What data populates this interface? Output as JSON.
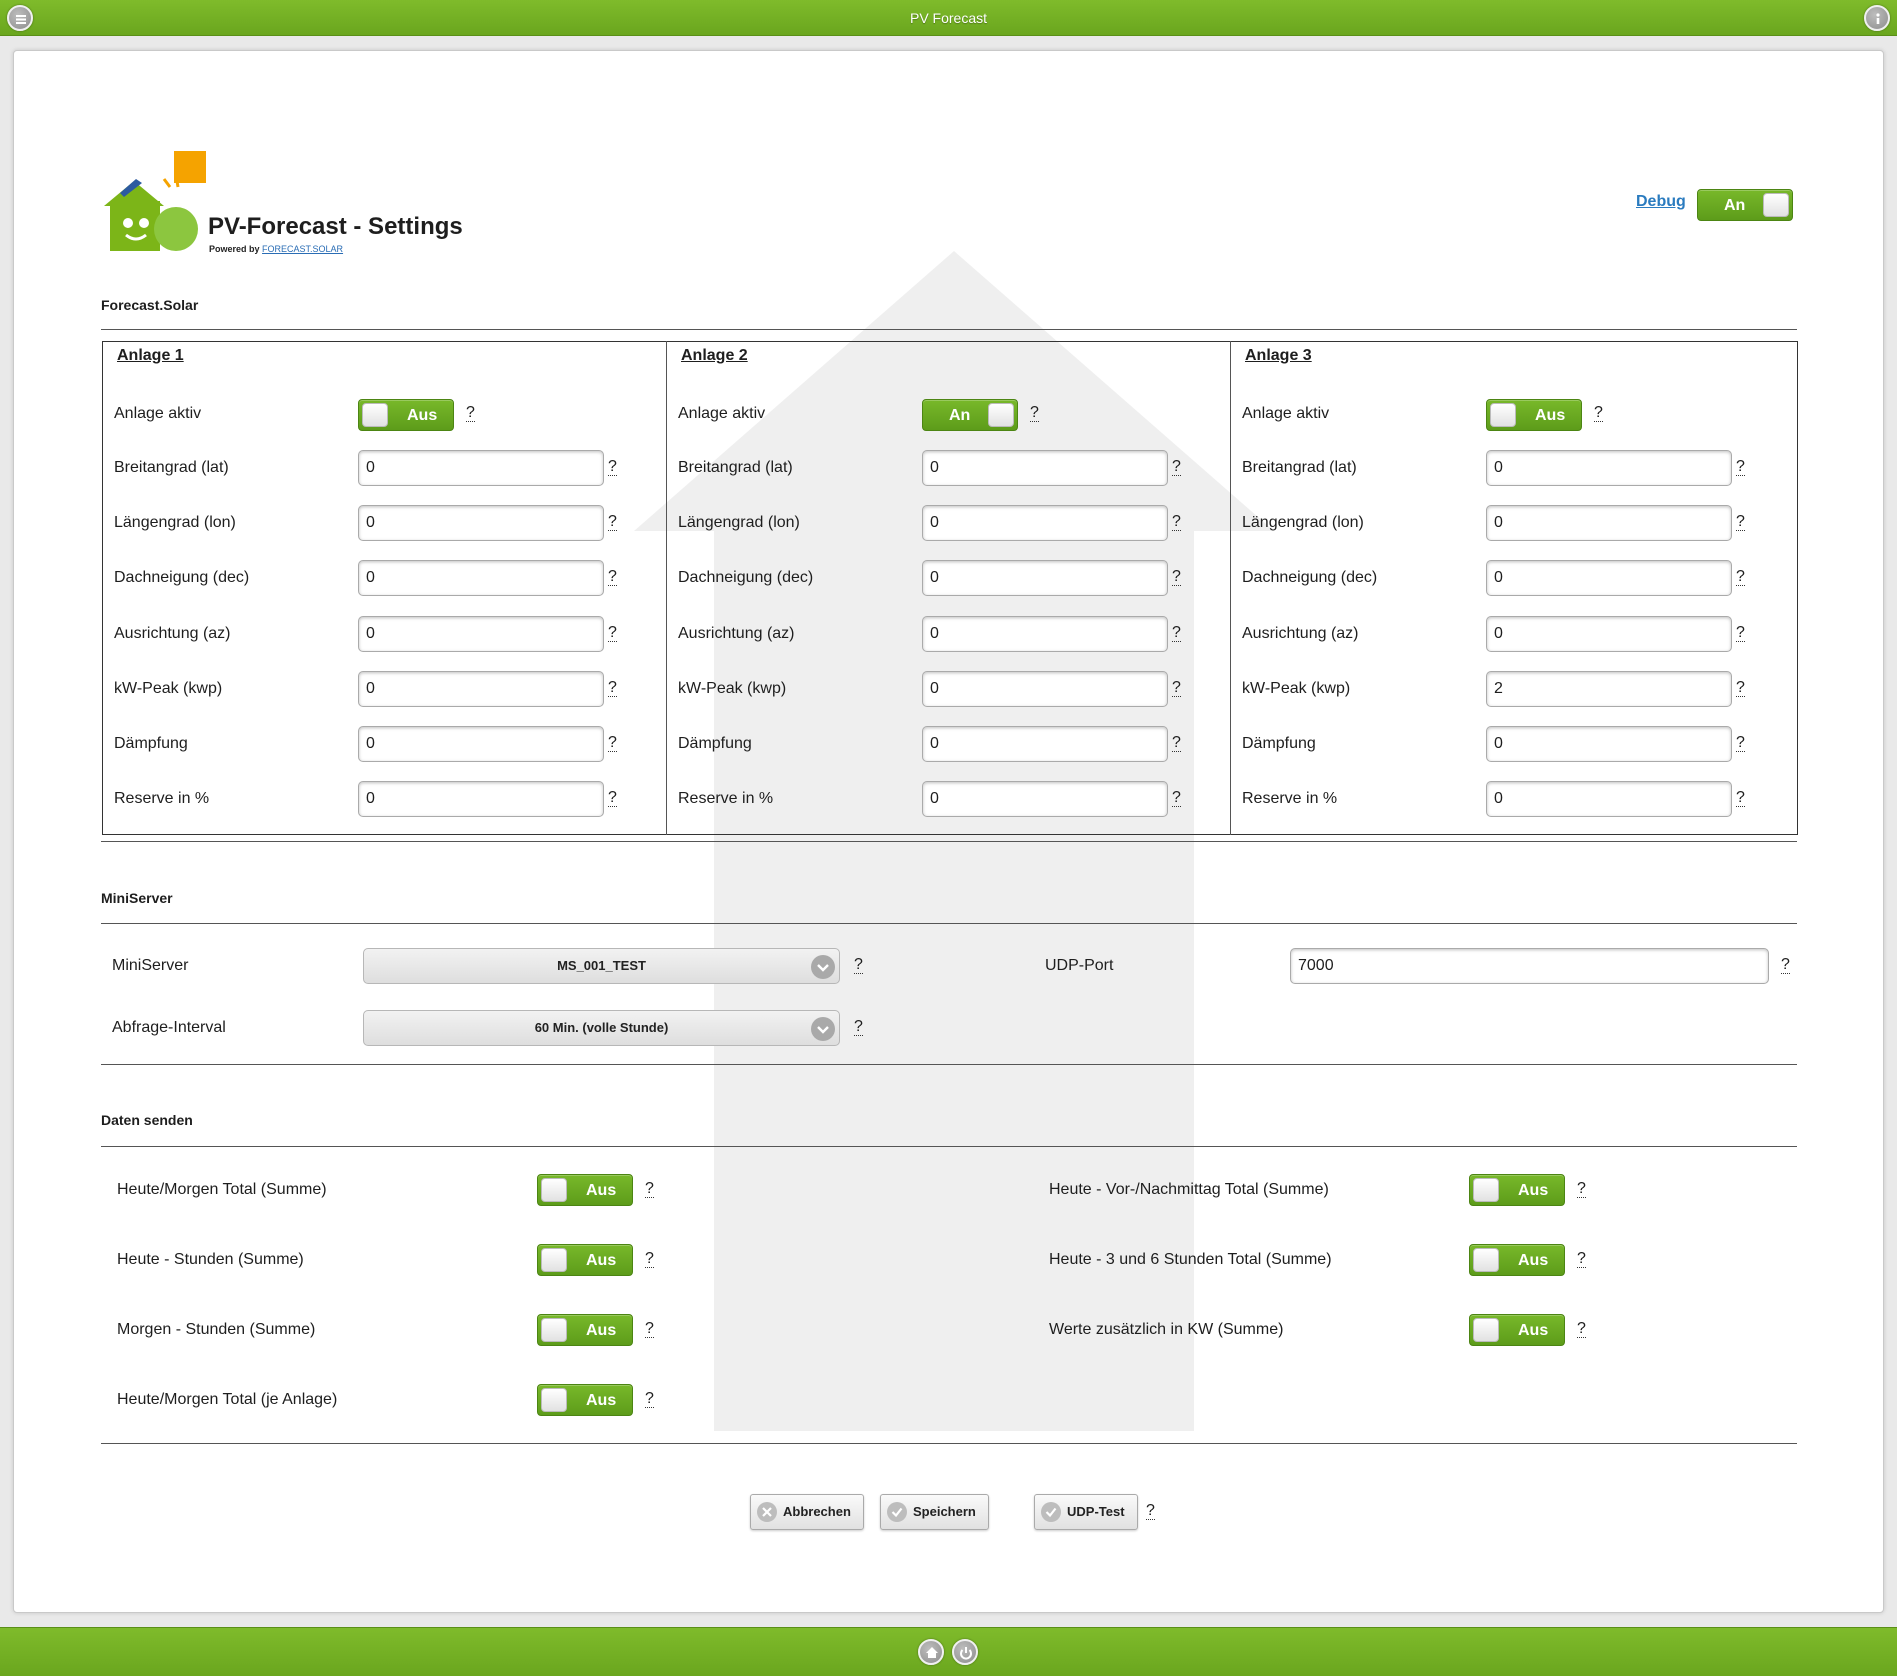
{
  "window": {
    "title": "PV Forecast"
  },
  "header": {
    "title": "PV-Forecast - Settings",
    "powered_by": "Powered by",
    "powered_link": "FORECAST.SOLAR",
    "debug_label": "Debug",
    "debug_state": "An"
  },
  "forecast_section": {
    "title": "Forecast.Solar"
  },
  "field_labels": {
    "active": "Anlage aktiv",
    "lat": "Breitangrad (lat)",
    "lon": "Längengrad (lon)",
    "dec": "Dachneigung (dec)",
    "az": "Ausrichtung (az)",
    "kwp": "kW-Peak (kwp)",
    "damping": "Dämpfung",
    "reserve": "Reserve in %"
  },
  "help_mark": "?",
  "anlagen": [
    {
      "title": "Anlage 1",
      "active": "Aus",
      "lat": "0",
      "lon": "0",
      "dec": "0",
      "az": "0",
      "kwp": "0",
      "damping": "0",
      "reserve": "0"
    },
    {
      "title": "Anlage 2",
      "active": "An",
      "lat": "0",
      "lon": "0",
      "dec": "0",
      "az": "0",
      "kwp": "0",
      "damping": "0",
      "reserve": "0"
    },
    {
      "title": "Anlage 3",
      "active": "Aus",
      "lat": "0",
      "lon": "0",
      "dec": "0",
      "az": "0",
      "kwp": "2",
      "damping": "0",
      "reserve": "0"
    }
  ],
  "miniserver_section": {
    "title": "MiniServer",
    "miniserver_label": "MiniServer",
    "miniserver_value": "MS_001_TEST",
    "interval_label": "Abfrage-Interval",
    "interval_value": "60 Min. (volle Stunde)",
    "udp_label": "UDP-Port",
    "udp_value": "7000"
  },
  "send_section": {
    "title": "Daten senden",
    "items": [
      {
        "label": "Heute/Morgen Total (Summe)",
        "state": "Aus"
      },
      {
        "label": "Heute - Stunden (Summe)",
        "state": "Aus"
      },
      {
        "label": "Morgen - Stunden (Summe)",
        "state": "Aus"
      },
      {
        "label": "Heute/Morgen Total (je Anlage)",
        "state": "Aus"
      },
      {
        "label": "Heute - Vor-/Nachmittag Total (Summe)",
        "state": "Aus"
      },
      {
        "label": "Heute - 3 und 6 Stunden Total (Summe)",
        "state": "Aus"
      },
      {
        "label": "Werte zusätzlich in KW (Summe)",
        "state": "Aus"
      }
    ]
  },
  "actions": {
    "cancel": "Abbrechen",
    "save": "Speichern",
    "udp_test": "UDP-Test"
  },
  "colors": {
    "accent": "#6aa61e",
    "link": "#2a7bbf"
  },
  "icons": {
    "menu": "menu-icon",
    "info": "info-icon",
    "home": "home-icon",
    "power": "power-icon",
    "cancel": "close-icon",
    "save": "check-icon",
    "udp": "check-icon"
  }
}
